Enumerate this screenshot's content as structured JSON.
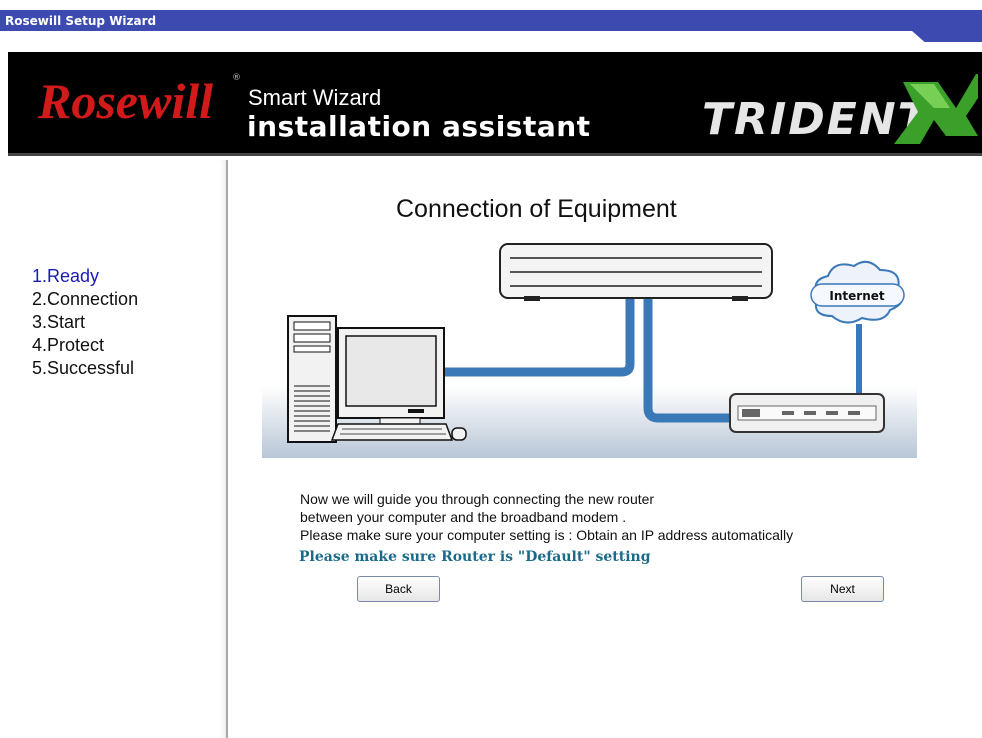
{
  "window": {
    "title": "Rosewill Setup Wizard"
  },
  "header": {
    "brand": "Rosewill",
    "subtitle": "Smart Wizard",
    "title": "installation assistant",
    "product_logo": "TRIDENT X"
  },
  "sidebar": {
    "steps": [
      {
        "label": "1.Ready",
        "active": true
      },
      {
        "label": "2.Connection",
        "active": false
      },
      {
        "label": "3.Start",
        "active": false
      },
      {
        "label": "4.Protect",
        "active": false
      },
      {
        "label": "5.Successful",
        "active": false
      }
    ]
  },
  "main": {
    "heading": "Connection of Equipment",
    "diagram": {
      "cloud_label": "Internet"
    },
    "instructions": [
      "Now we will guide you through connecting the new router",
      "between your computer and the broadband modem .",
      "Please make sure your computer setting is : Obtain an IP address automatically"
    ],
    "note": "Please make sure Router is \"Default\" setting",
    "back_label": "Back",
    "next_label": "Next"
  },
  "colors": {
    "titlebar": "#3d4bb0",
    "active_step": "#1a1ab8",
    "cable": "#3a78b8",
    "note": "#1a6a8a"
  }
}
